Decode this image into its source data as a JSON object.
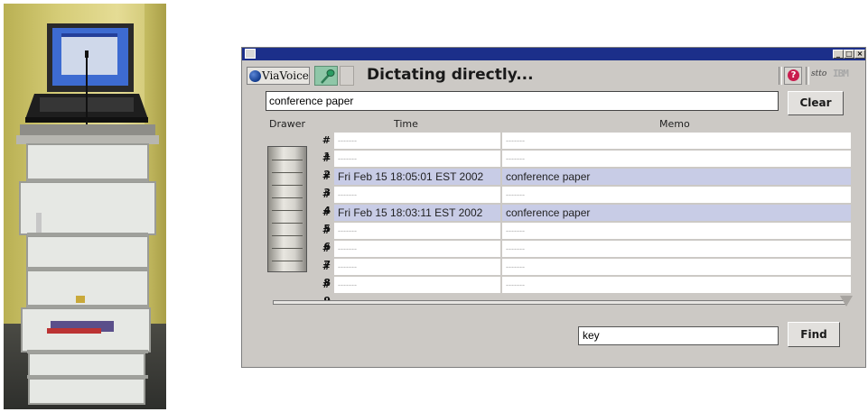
{
  "window": {
    "app_logo_text": "ViaVoice",
    "status_text": "Dictating directly...",
    "titlebar_buttons": [
      "_",
      "□",
      "×"
    ],
    "brand_small_1": "stto",
    "brand_small_2": "IBM"
  },
  "search": {
    "value": "conference paper",
    "clear_label": "Clear"
  },
  "table": {
    "headers": {
      "drawer": "Drawer",
      "time": "Time",
      "memo": "Memo"
    },
    "rows": [
      {
        "num": "# 1",
        "time": "-------",
        "memo": "-------"
      },
      {
        "num": "# 2",
        "time": "-------",
        "memo": "-------"
      },
      {
        "num": "# 3",
        "time": "Fri Feb 15 18:05:01 EST 2002",
        "memo": "conference paper"
      },
      {
        "num": "# 4",
        "time": "-------",
        "memo": "-------"
      },
      {
        "num": "# 5",
        "time": "Fri Feb 15 18:03:11 EST 2002",
        "memo": "conference paper"
      },
      {
        "num": "# 6",
        "time": "-------",
        "memo": "-------"
      },
      {
        "num": "# 7",
        "time": "-------",
        "memo": "-------"
      },
      {
        "num": "# 8",
        "time": "-------",
        "memo": "-------"
      },
      {
        "num": "# 9",
        "time": "-------",
        "memo": "-------"
      }
    ],
    "highlight_color": "#c8cce6"
  },
  "find": {
    "value": "key",
    "button_label": "Find"
  },
  "slider": {
    "value_fraction": 1.0
  },
  "colors": {
    "titlebar": "#1c2f8a",
    "window_bg": "#ccc9c5",
    "help_icon": "#c91c4e"
  },
  "icons": [
    "globe-icon",
    "microphone-icon",
    "help-icon",
    "minimize-icon",
    "maximize-icon",
    "close-icon"
  ]
}
